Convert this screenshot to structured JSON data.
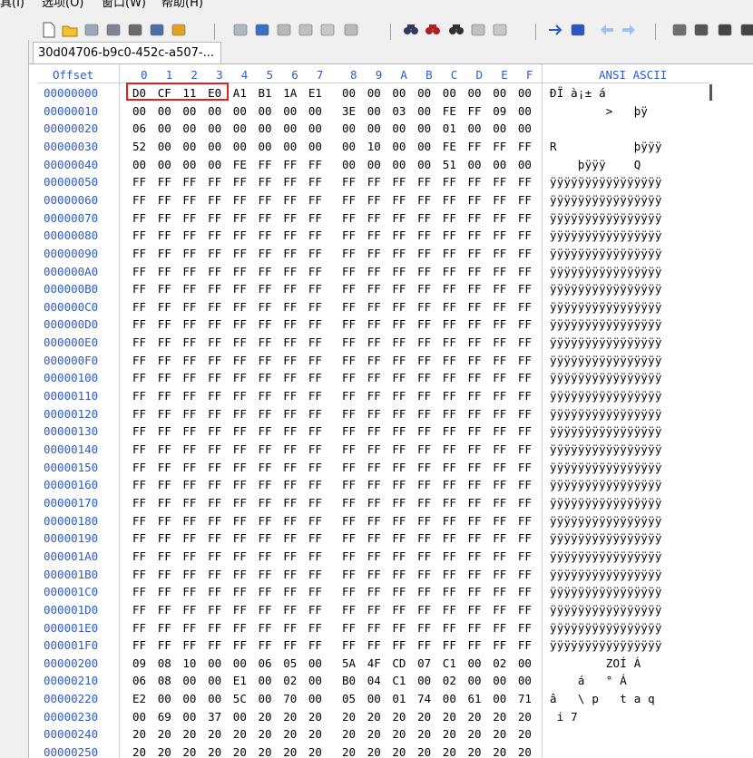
{
  "menu": [
    "具(I)",
    "选项(O)",
    "窗口(W)",
    "帮助(H)"
  ],
  "toolbar_icons": [
    "new-file-icon",
    "open-folder-icon",
    "save-icon",
    "print-preview-icon",
    "print-icon",
    "properties-icon",
    "upload-icon",
    "undo-icon",
    "copy-icon",
    "paste-icon",
    "paste-special-icon",
    "copy-hex-icon",
    "binary-icon",
    "find-icon",
    "find-next-icon",
    "find-hex-icon",
    "replace-icon",
    "replace-hex-icon",
    "goto-icon",
    "goto-offset-icon",
    "back-icon",
    "forward-icon",
    "disk-icon",
    "disk-edit-icon",
    "ram-icon",
    "calculator-icon"
  ],
  "tab": {
    "title": "30d04706-b9c0-452c-a507-..."
  },
  "header": {
    "offset": "Offset",
    "columns": [
      "0",
      "1",
      "2",
      "3",
      "4",
      "5",
      "6",
      "7",
      "8",
      "9",
      "A",
      "B",
      "C",
      "D",
      "E",
      "F"
    ],
    "ascii": "ANSI ASCII"
  },
  "rows": [
    {
      "offset": "00000000",
      "hex": [
        "D0",
        "CF",
        "11",
        "E0",
        "A1",
        "B1",
        "1A",
        "E1",
        "00",
        "00",
        "00",
        "00",
        "00",
        "00",
        "00",
        "00"
      ],
      "ascii": "ÐÏ à¡± á"
    },
    {
      "offset": "00000010",
      "hex": [
        "00",
        "00",
        "00",
        "00",
        "00",
        "00",
        "00",
        "00",
        "3E",
        "00",
        "03",
        "00",
        "FE",
        "FF",
        "09",
        "00"
      ],
      "ascii": "        >   þÿ"
    },
    {
      "offset": "00000020",
      "hex": [
        "06",
        "00",
        "00",
        "00",
        "00",
        "00",
        "00",
        "00",
        "00",
        "00",
        "00",
        "00",
        "01",
        "00",
        "00",
        "00"
      ],
      "ascii": ""
    },
    {
      "offset": "00000030",
      "hex": [
        "52",
        "00",
        "00",
        "00",
        "00",
        "00",
        "00",
        "00",
        "00",
        "10",
        "00",
        "00",
        "FE",
        "FF",
        "FF",
        "FF"
      ],
      "ascii": "R           þÿÿÿ"
    },
    {
      "offset": "00000040",
      "hex": [
        "00",
        "00",
        "00",
        "00",
        "FE",
        "FF",
        "FF",
        "FF",
        "00",
        "00",
        "00",
        "00",
        "51",
        "00",
        "00",
        "00"
      ],
      "ascii": "    þÿÿÿ    Q"
    },
    {
      "offset": "00000050",
      "hex": [
        "FF",
        "FF",
        "FF",
        "FF",
        "FF",
        "FF",
        "FF",
        "FF",
        "FF",
        "FF",
        "FF",
        "FF",
        "FF",
        "FF",
        "FF",
        "FF"
      ],
      "ascii": "ÿÿÿÿÿÿÿÿÿÿÿÿÿÿÿÿ"
    },
    {
      "offset": "00000060",
      "hex": [
        "FF",
        "FF",
        "FF",
        "FF",
        "FF",
        "FF",
        "FF",
        "FF",
        "FF",
        "FF",
        "FF",
        "FF",
        "FF",
        "FF",
        "FF",
        "FF"
      ],
      "ascii": "ÿÿÿÿÿÿÿÿÿÿÿÿÿÿÿÿ"
    },
    {
      "offset": "00000070",
      "hex": [
        "FF",
        "FF",
        "FF",
        "FF",
        "FF",
        "FF",
        "FF",
        "FF",
        "FF",
        "FF",
        "FF",
        "FF",
        "FF",
        "FF",
        "FF",
        "FF"
      ],
      "ascii": "ÿÿÿÿÿÿÿÿÿÿÿÿÿÿÿÿ"
    },
    {
      "offset": "00000080",
      "hex": [
        "FF",
        "FF",
        "FF",
        "FF",
        "FF",
        "FF",
        "FF",
        "FF",
        "FF",
        "FF",
        "FF",
        "FF",
        "FF",
        "FF",
        "FF",
        "FF"
      ],
      "ascii": "ÿÿÿÿÿÿÿÿÿÿÿÿÿÿÿÿ"
    },
    {
      "offset": "00000090",
      "hex": [
        "FF",
        "FF",
        "FF",
        "FF",
        "FF",
        "FF",
        "FF",
        "FF",
        "FF",
        "FF",
        "FF",
        "FF",
        "FF",
        "FF",
        "FF",
        "FF"
      ],
      "ascii": "ÿÿÿÿÿÿÿÿÿÿÿÿÿÿÿÿ"
    },
    {
      "offset": "000000A0",
      "hex": [
        "FF",
        "FF",
        "FF",
        "FF",
        "FF",
        "FF",
        "FF",
        "FF",
        "FF",
        "FF",
        "FF",
        "FF",
        "FF",
        "FF",
        "FF",
        "FF"
      ],
      "ascii": "ÿÿÿÿÿÿÿÿÿÿÿÿÿÿÿÿ"
    },
    {
      "offset": "000000B0",
      "hex": [
        "FF",
        "FF",
        "FF",
        "FF",
        "FF",
        "FF",
        "FF",
        "FF",
        "FF",
        "FF",
        "FF",
        "FF",
        "FF",
        "FF",
        "FF",
        "FF"
      ],
      "ascii": "ÿÿÿÿÿÿÿÿÿÿÿÿÿÿÿÿ"
    },
    {
      "offset": "000000C0",
      "hex": [
        "FF",
        "FF",
        "FF",
        "FF",
        "FF",
        "FF",
        "FF",
        "FF",
        "FF",
        "FF",
        "FF",
        "FF",
        "FF",
        "FF",
        "FF",
        "FF"
      ],
      "ascii": "ÿÿÿÿÿÿÿÿÿÿÿÿÿÿÿÿ"
    },
    {
      "offset": "000000D0",
      "hex": [
        "FF",
        "FF",
        "FF",
        "FF",
        "FF",
        "FF",
        "FF",
        "FF",
        "FF",
        "FF",
        "FF",
        "FF",
        "FF",
        "FF",
        "FF",
        "FF"
      ],
      "ascii": "ÿÿÿÿÿÿÿÿÿÿÿÿÿÿÿÿ"
    },
    {
      "offset": "000000E0",
      "hex": [
        "FF",
        "FF",
        "FF",
        "FF",
        "FF",
        "FF",
        "FF",
        "FF",
        "FF",
        "FF",
        "FF",
        "FF",
        "FF",
        "FF",
        "FF",
        "FF"
      ],
      "ascii": "ÿÿÿÿÿÿÿÿÿÿÿÿÿÿÿÿ"
    },
    {
      "offset": "000000F0",
      "hex": [
        "FF",
        "FF",
        "FF",
        "FF",
        "FF",
        "FF",
        "FF",
        "FF",
        "FF",
        "FF",
        "FF",
        "FF",
        "FF",
        "FF",
        "FF",
        "FF"
      ],
      "ascii": "ÿÿÿÿÿÿÿÿÿÿÿÿÿÿÿÿ"
    },
    {
      "offset": "00000100",
      "hex": [
        "FF",
        "FF",
        "FF",
        "FF",
        "FF",
        "FF",
        "FF",
        "FF",
        "FF",
        "FF",
        "FF",
        "FF",
        "FF",
        "FF",
        "FF",
        "FF"
      ],
      "ascii": "ÿÿÿÿÿÿÿÿÿÿÿÿÿÿÿÿ"
    },
    {
      "offset": "00000110",
      "hex": [
        "FF",
        "FF",
        "FF",
        "FF",
        "FF",
        "FF",
        "FF",
        "FF",
        "FF",
        "FF",
        "FF",
        "FF",
        "FF",
        "FF",
        "FF",
        "FF"
      ],
      "ascii": "ÿÿÿÿÿÿÿÿÿÿÿÿÿÿÿÿ"
    },
    {
      "offset": "00000120",
      "hex": [
        "FF",
        "FF",
        "FF",
        "FF",
        "FF",
        "FF",
        "FF",
        "FF",
        "FF",
        "FF",
        "FF",
        "FF",
        "FF",
        "FF",
        "FF",
        "FF"
      ],
      "ascii": "ÿÿÿÿÿÿÿÿÿÿÿÿÿÿÿÿ"
    },
    {
      "offset": "00000130",
      "hex": [
        "FF",
        "FF",
        "FF",
        "FF",
        "FF",
        "FF",
        "FF",
        "FF",
        "FF",
        "FF",
        "FF",
        "FF",
        "FF",
        "FF",
        "FF",
        "FF"
      ],
      "ascii": "ÿÿÿÿÿÿÿÿÿÿÿÿÿÿÿÿ"
    },
    {
      "offset": "00000140",
      "hex": [
        "FF",
        "FF",
        "FF",
        "FF",
        "FF",
        "FF",
        "FF",
        "FF",
        "FF",
        "FF",
        "FF",
        "FF",
        "FF",
        "FF",
        "FF",
        "FF"
      ],
      "ascii": "ÿÿÿÿÿÿÿÿÿÿÿÿÿÿÿÿ"
    },
    {
      "offset": "00000150",
      "hex": [
        "FF",
        "FF",
        "FF",
        "FF",
        "FF",
        "FF",
        "FF",
        "FF",
        "FF",
        "FF",
        "FF",
        "FF",
        "FF",
        "FF",
        "FF",
        "FF"
      ],
      "ascii": "ÿÿÿÿÿÿÿÿÿÿÿÿÿÿÿÿ"
    },
    {
      "offset": "00000160",
      "hex": [
        "FF",
        "FF",
        "FF",
        "FF",
        "FF",
        "FF",
        "FF",
        "FF",
        "FF",
        "FF",
        "FF",
        "FF",
        "FF",
        "FF",
        "FF",
        "FF"
      ],
      "ascii": "ÿÿÿÿÿÿÿÿÿÿÿÿÿÿÿÿ"
    },
    {
      "offset": "00000170",
      "hex": [
        "FF",
        "FF",
        "FF",
        "FF",
        "FF",
        "FF",
        "FF",
        "FF",
        "FF",
        "FF",
        "FF",
        "FF",
        "FF",
        "FF",
        "FF",
        "FF"
      ],
      "ascii": "ÿÿÿÿÿÿÿÿÿÿÿÿÿÿÿÿ"
    },
    {
      "offset": "00000180",
      "hex": [
        "FF",
        "FF",
        "FF",
        "FF",
        "FF",
        "FF",
        "FF",
        "FF",
        "FF",
        "FF",
        "FF",
        "FF",
        "FF",
        "FF",
        "FF",
        "FF"
      ],
      "ascii": "ÿÿÿÿÿÿÿÿÿÿÿÿÿÿÿÿ"
    },
    {
      "offset": "00000190",
      "hex": [
        "FF",
        "FF",
        "FF",
        "FF",
        "FF",
        "FF",
        "FF",
        "FF",
        "FF",
        "FF",
        "FF",
        "FF",
        "FF",
        "FF",
        "FF",
        "FF"
      ],
      "ascii": "ÿÿÿÿÿÿÿÿÿÿÿÿÿÿÿÿ"
    },
    {
      "offset": "000001A0",
      "hex": [
        "FF",
        "FF",
        "FF",
        "FF",
        "FF",
        "FF",
        "FF",
        "FF",
        "FF",
        "FF",
        "FF",
        "FF",
        "FF",
        "FF",
        "FF",
        "FF"
      ],
      "ascii": "ÿÿÿÿÿÿÿÿÿÿÿÿÿÿÿÿ"
    },
    {
      "offset": "000001B0",
      "hex": [
        "FF",
        "FF",
        "FF",
        "FF",
        "FF",
        "FF",
        "FF",
        "FF",
        "FF",
        "FF",
        "FF",
        "FF",
        "FF",
        "FF",
        "FF",
        "FF"
      ],
      "ascii": "ÿÿÿÿÿÿÿÿÿÿÿÿÿÿÿÿ"
    },
    {
      "offset": "000001C0",
      "hex": [
        "FF",
        "FF",
        "FF",
        "FF",
        "FF",
        "FF",
        "FF",
        "FF",
        "FF",
        "FF",
        "FF",
        "FF",
        "FF",
        "FF",
        "FF",
        "FF"
      ],
      "ascii": "ÿÿÿÿÿÿÿÿÿÿÿÿÿÿÿÿ"
    },
    {
      "offset": "000001D0",
      "hex": [
        "FF",
        "FF",
        "FF",
        "FF",
        "FF",
        "FF",
        "FF",
        "FF",
        "FF",
        "FF",
        "FF",
        "FF",
        "FF",
        "FF",
        "FF",
        "FF"
      ],
      "ascii": "ÿÿÿÿÿÿÿÿÿÿÿÿÿÿÿÿ"
    },
    {
      "offset": "000001E0",
      "hex": [
        "FF",
        "FF",
        "FF",
        "FF",
        "FF",
        "FF",
        "FF",
        "FF",
        "FF",
        "FF",
        "FF",
        "FF",
        "FF",
        "FF",
        "FF",
        "FF"
      ],
      "ascii": "ÿÿÿÿÿÿÿÿÿÿÿÿÿÿÿÿ"
    },
    {
      "offset": "000001F0",
      "hex": [
        "FF",
        "FF",
        "FF",
        "FF",
        "FF",
        "FF",
        "FF",
        "FF",
        "FF",
        "FF",
        "FF",
        "FF",
        "FF",
        "FF",
        "FF",
        "FF"
      ],
      "ascii": "ÿÿÿÿÿÿÿÿÿÿÿÿÿÿÿÿ"
    },
    {
      "offset": "00000200",
      "hex": [
        "09",
        "08",
        "10",
        "00",
        "00",
        "06",
        "05",
        "00",
        "5A",
        "4F",
        "CD",
        "07",
        "C1",
        "00",
        "02",
        "00"
      ],
      "ascii": "        ZOÍ Á"
    },
    {
      "offset": "00000210",
      "hex": [
        "06",
        "08",
        "00",
        "00",
        "E1",
        "00",
        "02",
        "00",
        "B0",
        "04",
        "C1",
        "00",
        "02",
        "00",
        "00",
        "00"
      ],
      "ascii": "    á   ° Á"
    },
    {
      "offset": "00000220",
      "hex": [
        "E2",
        "00",
        "00",
        "00",
        "5C",
        "00",
        "70",
        "00",
        "05",
        "00",
        "01",
        "74",
        "00",
        "61",
        "00",
        "71"
      ],
      "ascii": "â   \\ p   t a q"
    },
    {
      "offset": "00000230",
      "hex": [
        "00",
        "69",
        "00",
        "37",
        "00",
        "20",
        "20",
        "20",
        "20",
        "20",
        "20",
        "20",
        "20",
        "20",
        "20",
        "20"
      ],
      "ascii": " i 7"
    },
    {
      "offset": "00000240",
      "hex": [
        "20",
        "20",
        "20",
        "20",
        "20",
        "20",
        "20",
        "20",
        "20",
        "20",
        "20",
        "20",
        "20",
        "20",
        "20",
        "20"
      ],
      "ascii": ""
    },
    {
      "offset": "00000250",
      "hex": [
        "20",
        "20",
        "20",
        "20",
        "20",
        "20",
        "20",
        "20",
        "20",
        "20",
        "20",
        "20",
        "20",
        "20",
        "20",
        "20"
      ],
      "ascii": ""
    }
  ],
  "highlight_color": "#e02020",
  "offset_color": "#2d5bc8"
}
